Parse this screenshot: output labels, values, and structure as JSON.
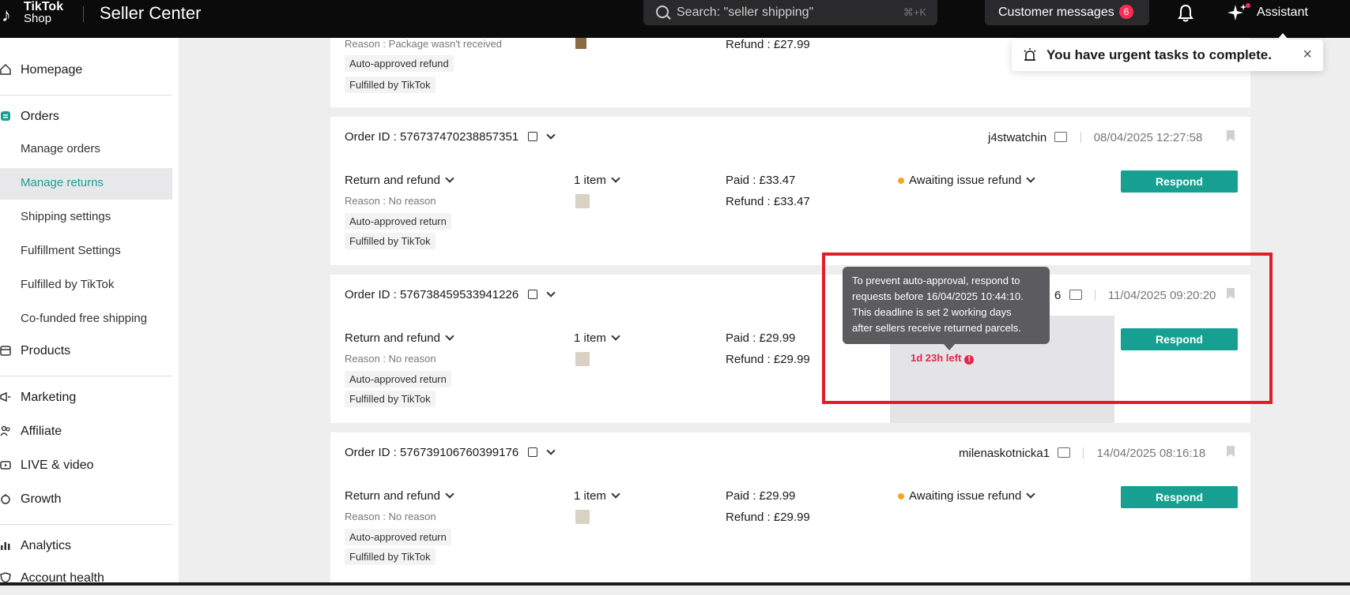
{
  "topbar": {
    "logo_line1": "TikTok",
    "logo_line2": "Shop",
    "app_title": "Seller Center",
    "search_placeholder": "Search: \"seller shipping\"",
    "search_shortcut": "⌘+K",
    "customer_messages_label": "Customer messages",
    "customer_messages_count": "6",
    "assistant_label": "Assistant"
  },
  "toast": {
    "text": "You have urgent tasks to complete.",
    "close": "×"
  },
  "sidebar": {
    "items": [
      {
        "label": "Homepage"
      },
      {
        "label": "Orders"
      },
      {
        "label": "Manage orders"
      },
      {
        "label": "Manage returns"
      },
      {
        "label": "Shipping settings"
      },
      {
        "label": "Fulfillment Settings"
      },
      {
        "label": "Fulfilled by TikTok"
      },
      {
        "label": "Co-funded free shipping"
      },
      {
        "label": "Products"
      },
      {
        "label": "Marketing"
      },
      {
        "label": "Affiliate"
      },
      {
        "label": "LIVE & video"
      },
      {
        "label": "Growth"
      },
      {
        "label": "Analytics"
      },
      {
        "label": "Account health"
      }
    ]
  },
  "orders": [
    {
      "reason": "Reason : Package wasn't received",
      "tag1": "Auto-approved refund",
      "tag2": "Fulfilled by TikTok",
      "refund": "Refund : £27.99"
    },
    {
      "order_id": "Order ID : 576737470238857351",
      "buyer": "j4stwatchin",
      "date": "08/04/2025 12:27:58",
      "type": "Return and refund",
      "reason": "Reason : No reason",
      "tag1": "Auto-approved return",
      "tag2": "Fulfilled by TikTok",
      "items": "1 item",
      "paid": "Paid : £33.47",
      "refund": "Refund : £33.47",
      "status": "Awaiting issue refund",
      "action": "Respond"
    },
    {
      "order_id": "Order ID : 576738459533941226",
      "buyer_partial": "6",
      "date": "11/04/2025 09:20:20",
      "type": "Return and refund",
      "reason": "Reason : No reason",
      "tag1": "Auto-approved return",
      "tag2": "Fulfilled by TikTok",
      "items": "1 item",
      "paid": "Paid : £29.99",
      "refund": "Refund : £29.99",
      "timer": "1d 23h left",
      "action": "Respond"
    },
    {
      "order_id": "Order ID : 576739106760399176",
      "buyer": "milenaskotnicka1",
      "date": "14/04/2025 08:16:18",
      "type": "Return and refund",
      "reason": "Reason : No reason",
      "tag1": "Auto-approved return",
      "tag2": "Fulfilled by TikTok",
      "items": "1 item",
      "paid": "Paid : £29.99",
      "refund": "Refund : £29.99",
      "status": "Awaiting issue refund",
      "action": "Respond"
    }
  ],
  "tooltip": {
    "line1": "To prevent auto-approval, respond to",
    "line2": "requests before 16/04/2025 10:44:10.",
    "line3": "This deadline is set 2 working days",
    "line4": "after sellers receive returned parcels."
  },
  "colors": {
    "brand_teal": "#17a091",
    "highlight_red": "#e01e27",
    "badge_red": "#fe2c55",
    "status_orange": "#f5a623"
  }
}
